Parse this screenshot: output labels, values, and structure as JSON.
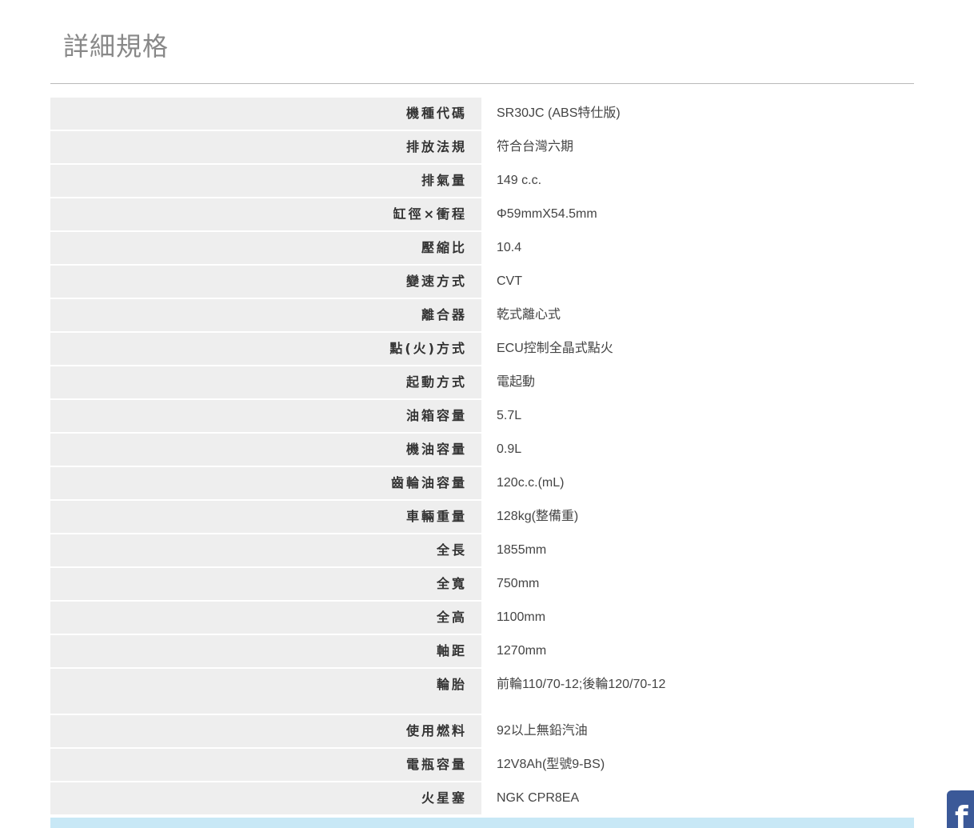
{
  "page": {
    "title": "詳細規格"
  },
  "specs": [
    {
      "label": "機種代碼",
      "value": "SR30JC (ABS特仕版)"
    },
    {
      "label": "排放法規",
      "value": "符合台灣六期"
    },
    {
      "label": "排氣量",
      "value": "149 c.c."
    },
    {
      "label": "缸徑×衝程",
      "value": "Φ59mmX54.5mm"
    },
    {
      "label": "壓縮比",
      "value": "10.4"
    },
    {
      "label": "變速方式",
      "value": "CVT"
    },
    {
      "label": "離合器",
      "value": "乾式離心式"
    },
    {
      "label": "點(火)方式",
      "value": "ECU控制全晶式點火"
    },
    {
      "label": "起動方式",
      "value": "電起動"
    },
    {
      "label": "油箱容量",
      "value": "5.7L"
    },
    {
      "label": "機油容量",
      "value": "0.9L"
    },
    {
      "label": "齒輪油容量",
      "value": "120c.c.(mL)"
    },
    {
      "label": "車輛重量",
      "value": "128kg(整備重)"
    },
    {
      "label": "全長",
      "value": "1855mm"
    },
    {
      "label": "全寬",
      "value": "750mm"
    },
    {
      "label": "全高",
      "value": "1100mm"
    },
    {
      "label": "軸距",
      "value": "1270mm"
    },
    {
      "label": "輪胎",
      "value": "前輪110/70-12;後輪120/70-12"
    },
    {
      "label": "使用燃料",
      "value": "92以上無鉛汽油"
    },
    {
      "label": "電瓶容量",
      "value": "12V8Ah(型號9-BS)"
    },
    {
      "label": "火星塞",
      "value": "NGK CPR8EA"
    }
  ],
  "social": {
    "icon": "facebook-icon",
    "glyph": "f",
    "color": "#3b5998"
  },
  "colors": {
    "label_bg": "#eeeeee",
    "accent_strip": "#c8e8f6"
  }
}
